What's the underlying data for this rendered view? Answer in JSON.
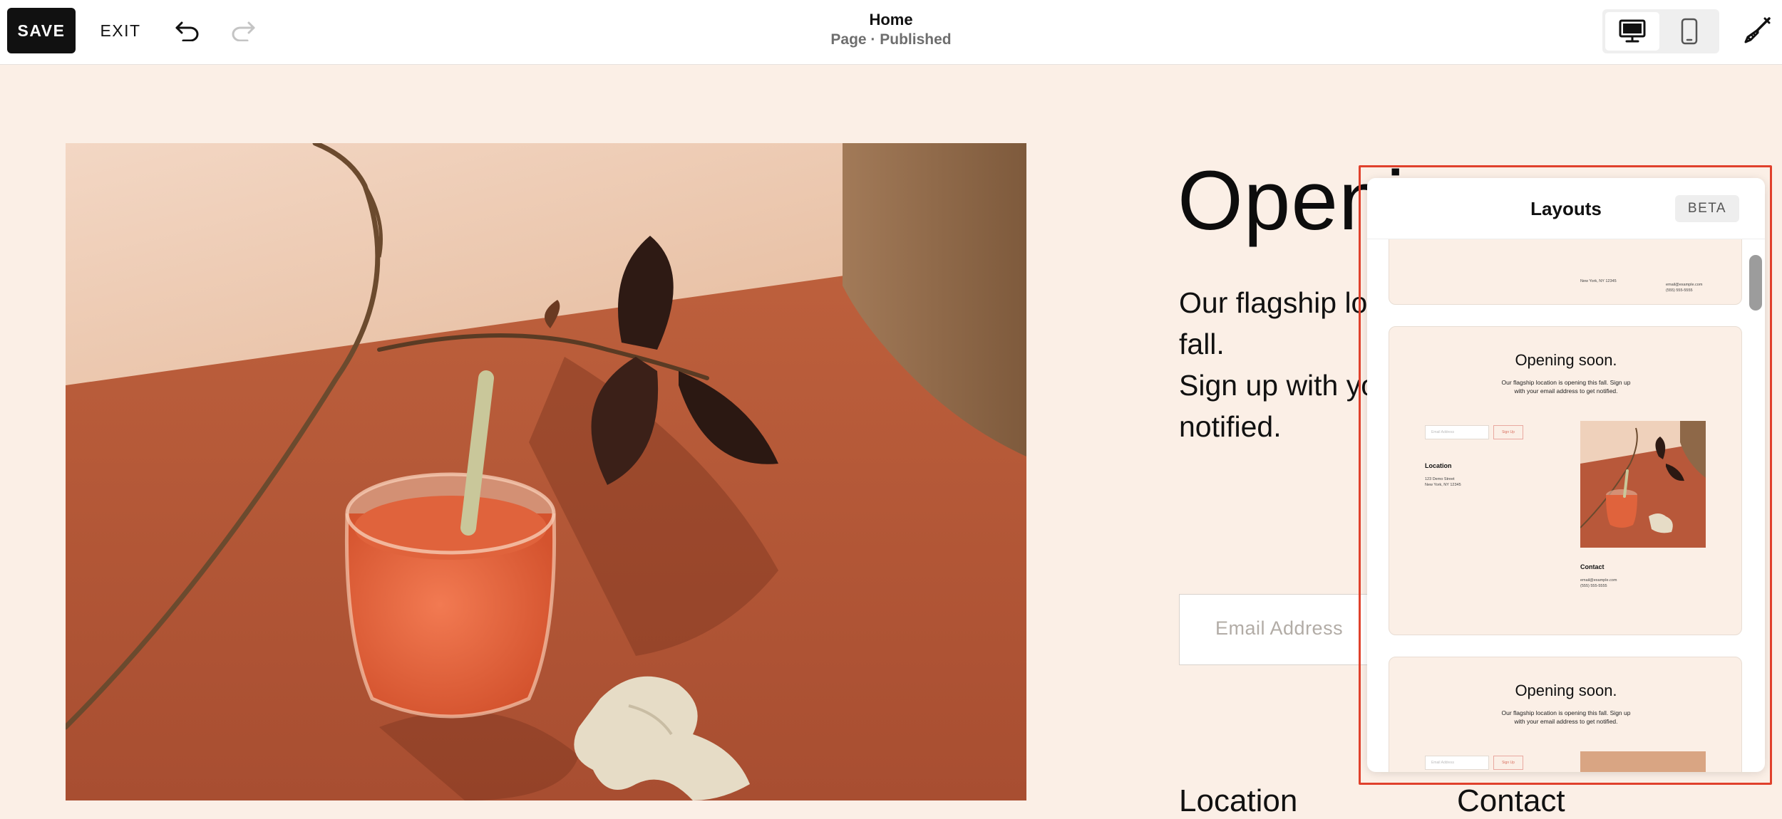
{
  "toolbar": {
    "save_label": "SAVE",
    "exit_label": "EXIT",
    "page_title": "Home",
    "page_status": "Page · Published"
  },
  "page": {
    "headline": "Opening soon.",
    "body_lines": [
      "Our flagship location is opening this fall.",
      "Sign up with your email address to get",
      "notified."
    ],
    "email_placeholder": "Email Address",
    "location_label": "Location",
    "contact_label": "Contact"
  },
  "layouts_panel": {
    "title": "Layouts",
    "badge": "BETA",
    "partial_card": {
      "address": "New York, NY 12345",
      "email": "email@example.com",
      "phone": "(555) 555-5555"
    },
    "cards": [
      {
        "title": "Opening soon.",
        "subtitle": "Our flagship location is opening this fall. Sign up with your email address to get notified.",
        "email_placeholder": "Email Address",
        "button": "Sign Up",
        "location_heading": "Location",
        "location_lines": [
          "123 Demo Street",
          "New York, NY 12345"
        ],
        "contact_heading": "Contact",
        "contact_lines": [
          "email@example.com",
          "(555) 555-5555"
        ]
      },
      {
        "title": "Opening soon.",
        "subtitle": "Our flagship location is opening this fall. Sign up with your email address to get notified.",
        "email_placeholder": "Email Address",
        "button": "Sign Up"
      }
    ]
  },
  "colors": {
    "accent_highlight": "#e0412c",
    "page_background": "#fbefe6",
    "photo_terracotta": "#b8583a"
  },
  "icons": [
    "undo-icon",
    "redo-icon",
    "desktop-icon",
    "mobile-icon",
    "paintbrush-icon"
  ]
}
